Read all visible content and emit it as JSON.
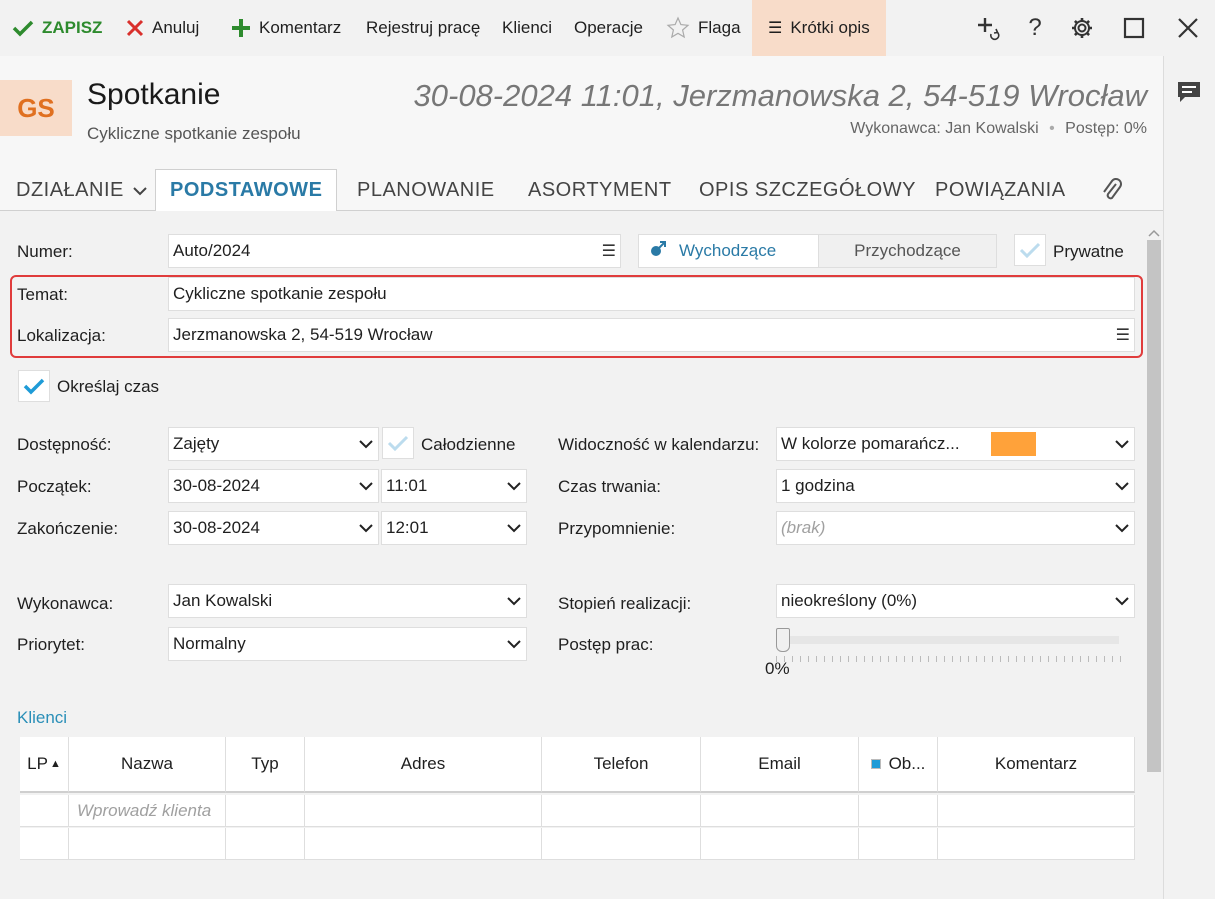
{
  "toolbar": {
    "save": "ZAPISZ",
    "cancel": "Anuluj",
    "comment": "Komentarz",
    "register_work": "Rejestruj pracę",
    "clients": "Klienci",
    "operations": "Operacje",
    "flag": "Flaga",
    "short_desc": "Krótki opis"
  },
  "header": {
    "avatar": "GS",
    "title": "Spotkanie",
    "subtitle": "Cykliczne spotkanie zespołu",
    "datetime_location": "30-08-2024 11:01, Jerzmanowska 2, 54-519 Wrocław",
    "executor_info": "Wykonawca: Jan Kowalski",
    "progress_info": "Postęp: 0%"
  },
  "tabs": {
    "action": "DZIAŁANIE",
    "basic": "PODSTAWOWE",
    "planning": "PLANOWANIE",
    "assortment": "ASORTYMENT",
    "detailed": "OPIS SZCZEGÓŁOWY",
    "relations": "POWIĄZANIA"
  },
  "form": {
    "number_label": "Numer:",
    "number_value": "Auto/2024",
    "outgoing": "Wychodzące",
    "incoming": "Przychodzące",
    "private": "Prywatne",
    "topic_label": "Temat:",
    "topic_value": "Cykliczne spotkanie zespołu",
    "location_label": "Lokalizacja:",
    "location_value": "Jerzmanowska 2, 54-519 Wrocław",
    "specify_time": "Określaj czas",
    "availability_label": "Dostępność:",
    "availability_value": "Zajęty",
    "all_day": "Całodzienne",
    "start_label": "Początek:",
    "start_date": "30-08-2024",
    "start_time": "11:01",
    "end_label": "Zakończenie:",
    "end_date": "30-08-2024",
    "end_time": "12:01",
    "visibility_label": "Widoczność w kalendarzu:",
    "visibility_value": "W kolorze pomarańcz...",
    "visibility_color": "#ffa23a",
    "duration_label": "Czas trwania:",
    "duration_value": "1 godzina",
    "reminder_label": "Przypomnienie:",
    "reminder_value": "(brak)",
    "executor_label": "Wykonawca:",
    "executor_value": "Jan Kowalski",
    "priority_label": "Priorytet:",
    "priority_value": "Normalny",
    "realization_label": "Stopień realizacji:",
    "realization_value": "nieokreślony  (0%)",
    "progress_label": "Postęp prac:",
    "progress_value": "0%",
    "progress_fraction": 0
  },
  "clients": {
    "section_title": "Klienci",
    "columns": [
      "LP",
      "Nazwa",
      "Typ",
      "Adres",
      "Telefon",
      "Email",
      "Ob...",
      "Komentarz"
    ],
    "placeholder": "Wprowadź klienta"
  },
  "colors": {
    "accent": "#2a7aa6",
    "save_green": "#2e8b2e",
    "cancel_red": "#d9302c",
    "highlight_red": "#e03c3c",
    "short_desc_bg": "#f8dcc9"
  }
}
